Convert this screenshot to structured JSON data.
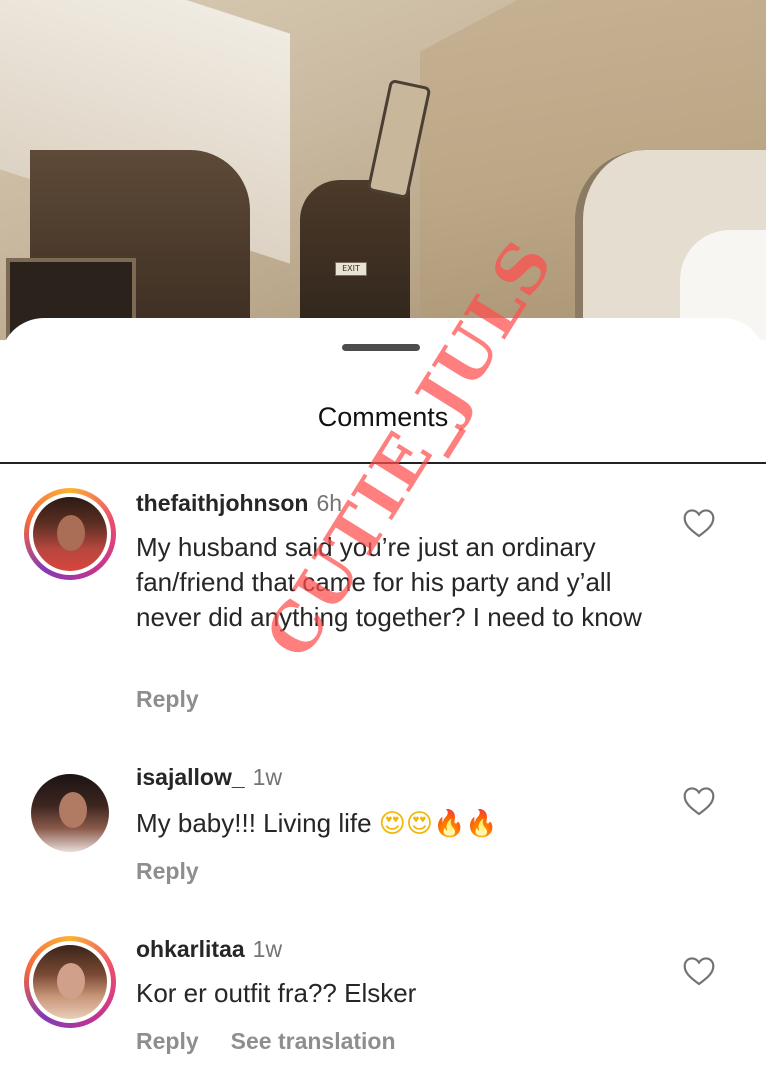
{
  "background_photo": {
    "exit_sign": "EXIT"
  },
  "sheet": {
    "title": "Comments"
  },
  "comments": [
    {
      "username": "thefaithjohnson",
      "time": "6h",
      "text": "My husband said you’re just an ordinary fan/friend that came for his party and y’all never did anything together? I need to know",
      "reply_label": "Reply",
      "story_ring": true
    },
    {
      "username": "isajallow_",
      "time": "1w",
      "text": "My baby!!! Living life",
      "emojis": [
        "😍",
        "😍",
        "🔥",
        "🔥"
      ],
      "reply_label": "Reply",
      "story_ring": false
    },
    {
      "username": "ohkarlitaa",
      "time": "1w",
      "text": "Kor er outfit fra?? Elsker",
      "reply_label": "Reply",
      "translation_label": "See translation",
      "story_ring": true
    }
  ],
  "watermark": "CUTIE_JULS",
  "colors": {
    "story_ring": [
      "#f9b233",
      "#ec4d6f",
      "#c4338f",
      "#833ab4"
    ],
    "text": "#262626",
    "secondary": "#8e8e8e",
    "watermark": "#ff4e4e"
  }
}
